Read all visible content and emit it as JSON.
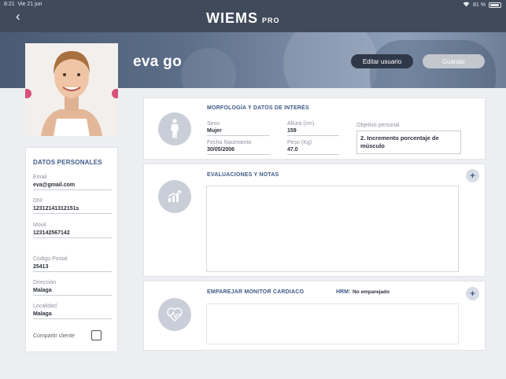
{
  "status_bar": {
    "time": "8:21",
    "date": "Vie 21 jun",
    "battery": "81 %"
  },
  "nav": {
    "brand": "WIEMS",
    "pro": "PRO"
  },
  "profile": {
    "name": "eva go"
  },
  "actions": {
    "edit": "Editar usuario",
    "save": "Guardar"
  },
  "personal": {
    "title": "DATOS PERSONALES",
    "email_label": "Email",
    "email": "eva@gmail.com",
    "dni_label": "DNI",
    "dni": "12312141312151s",
    "movil_label": "Movil",
    "movil": "123142567142",
    "cp_label": "Código Postal",
    "cp": "25413",
    "direccion_label": "Dirección",
    "direccion": "Malaga",
    "localidad_label": "Localidad",
    "localidad": "Malaga",
    "share_label": "Compartir cliente"
  },
  "morphology": {
    "title": "MORFOLOGÍA Y DATOS DE INTERÉS",
    "sexo_label": "Sexo",
    "sexo": "Mujer",
    "altura_label": "Altura (cm)",
    "altura": "159",
    "fecha_label": "Fecha Nacimiento",
    "fecha": "30/05/2006",
    "peso_label": "Peso (Kg)",
    "peso": "47.0",
    "objetivo_label": "Objetivo personal",
    "objetivo": "2. Incremento porcentaje de músculo"
  },
  "evaluations": {
    "title": "EVALUACIONES Y NOTAS",
    "add": "+"
  },
  "monitor": {
    "title": "EMPAREJAR MONITOR CARDIACO",
    "hrm_label": "HRM:",
    "hrm_value": "No emparejado",
    "add": "+"
  },
  "colors": {
    "topbar": "#3f4a5a",
    "accent": "#3d5a86",
    "icon_bg": "#c9ced8"
  }
}
